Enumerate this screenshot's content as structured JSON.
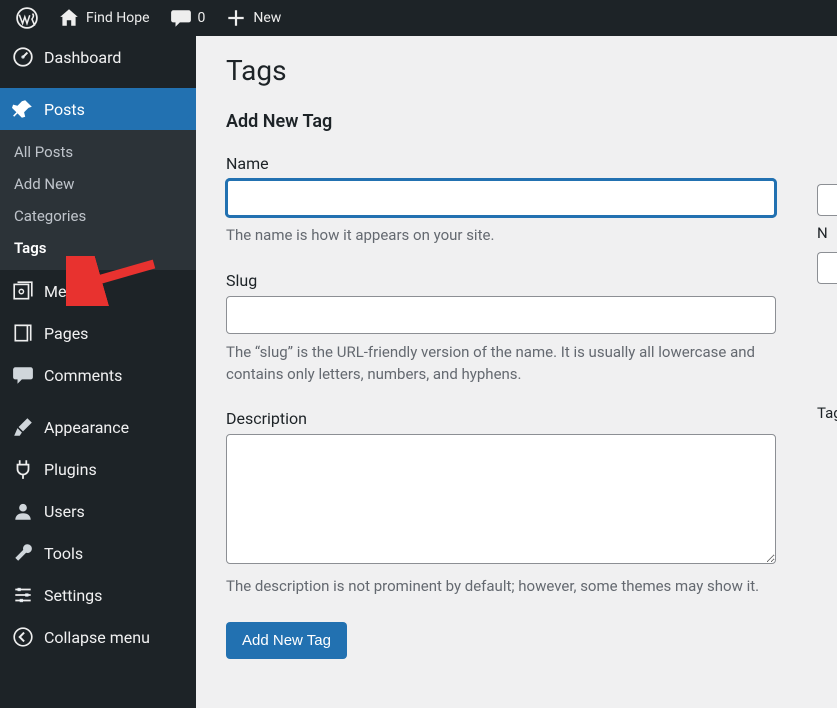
{
  "topbar": {
    "site_name": "Find Hope",
    "comments_count": "0",
    "new_label": "New"
  },
  "sidebar": {
    "dashboard": "Dashboard",
    "posts": "Posts",
    "posts_sub": {
      "all": "All Posts",
      "add": "Add New",
      "categories": "Categories",
      "tags": "Tags"
    },
    "media": "Media",
    "pages": "Pages",
    "comments": "Comments",
    "appearance": "Appearance",
    "plugins": "Plugins",
    "users": "Users",
    "tools": "Tools",
    "settings": "Settings",
    "collapse": "Collapse menu"
  },
  "main": {
    "page_title": "Tags",
    "section_title": "Add New Tag",
    "name_label": "Name",
    "name_value": "",
    "name_help": "The name is how it appears on your site.",
    "slug_label": "Slug",
    "slug_value": "",
    "slug_help": "The “slug” is the URL-friendly version of the name. It is usually all lowercase and contains only letters, numbers, and hyphens.",
    "desc_label": "Description",
    "desc_value": "",
    "desc_help": "The description is not prominent by default; however, some themes may show it.",
    "submit_label": "Add New Tag"
  },
  "right": {
    "n_label": "N",
    "tag_cut": "Tag"
  }
}
